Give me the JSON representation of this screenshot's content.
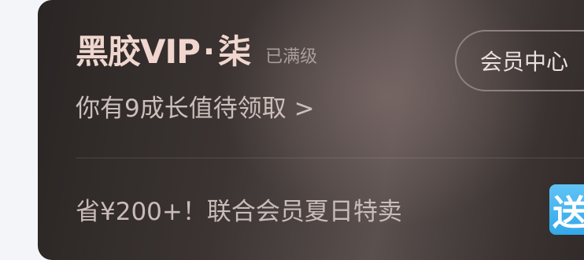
{
  "card": {
    "brand_name": "黑胶VIP",
    "brand_separator": "·",
    "level_name": "柒",
    "level_status": "已满级",
    "growth_link": "你有9成长值待领取 >",
    "member_center_label": "会员中心",
    "promo_text": "省¥200+！联合会员夏日特卖",
    "gift_badge_text": "送"
  }
}
